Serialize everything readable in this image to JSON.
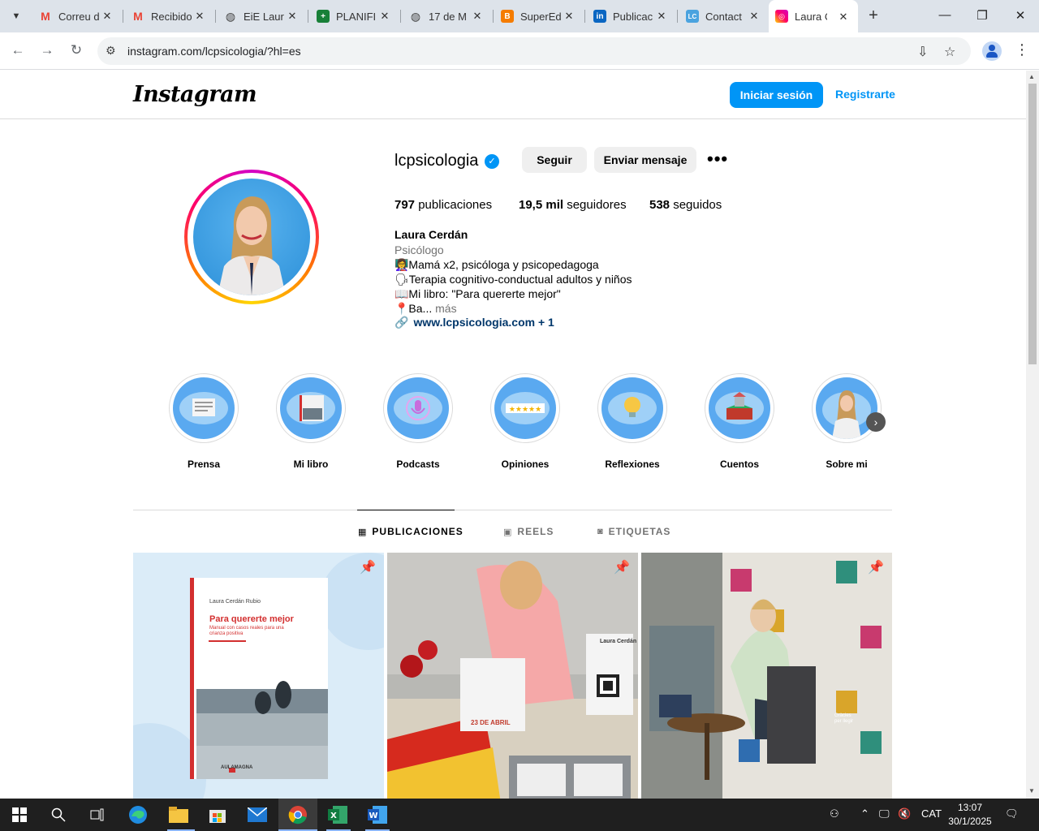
{
  "browser": {
    "tabs": [
      {
        "label": "Correu d",
        "favicon": "gmail-icon",
        "color": "#ea4335"
      },
      {
        "label": "Recibido",
        "favicon": "gmail-icon",
        "color": "#ea4335"
      },
      {
        "label": "EiE Laur",
        "favicon": "globe-icon",
        "color": "#444444"
      },
      {
        "label": "PLANIFI",
        "favicon": "sheets-icon",
        "color": "#188038"
      },
      {
        "label": "17 de M",
        "favicon": "globe-icon",
        "color": "#444444"
      },
      {
        "label": "SuperEd",
        "favicon": "blogger-icon",
        "color": "#f57c00"
      },
      {
        "label": "Publicac",
        "favicon": "linkedin-icon",
        "color": "#0a66c2"
      },
      {
        "label": "Contact",
        "favicon": "lc-icon",
        "color": "#4aa3df"
      },
      {
        "label": "Laura Ce",
        "favicon": "instagram-icon",
        "color": "#e1306c",
        "active": true
      }
    ],
    "url": "instagram.com/lcpsicologia/?hl=es"
  },
  "header": {
    "logo": "Instagram",
    "login_label": "Iniciar sesión",
    "register_label": "Registrarte"
  },
  "profile": {
    "username": "lcpsicologia",
    "follow_label": "Seguir",
    "message_label": "Enviar mensaje",
    "more_label": "•••",
    "stats": {
      "posts_count": "797",
      "posts_label": "publicaciones",
      "followers_count": "19,5 mil",
      "followers_label": "seguidores",
      "following_count": "538",
      "following_label": "seguidos"
    },
    "full_name": "Laura Cerdán",
    "category": "Psicólogo",
    "bio": [
      "👩‍🏫Mamá x2, psicóloga y psicopedagoga",
      "🗣Terapia cognitivo-conductual adultos y niños",
      "📖Mi libro: \"Para quererte mejor\"",
      "📍Ba..."
    ],
    "bio_more": "más",
    "link": "www.lcpsicologia.com + 1"
  },
  "highlights": [
    {
      "label": "Prensa"
    },
    {
      "label": "Mi libro"
    },
    {
      "label": "Podcasts"
    },
    {
      "label": "Opiniones"
    },
    {
      "label": "Reflexiones"
    },
    {
      "label": "Cuentos"
    },
    {
      "label": "Sobre mi"
    }
  ],
  "profile_tabs": {
    "posts": "PUBLICACIONES",
    "reels": "REELS",
    "tagged": "ETIQUETAS"
  },
  "posts": {
    "book": {
      "author": "Laura Cerdán Rubio",
      "title": "Para quererte mejor",
      "subtitle": "Manual con casos reales para una crianza positiva",
      "publisher": "AULAMAGNA"
    },
    "signing": {
      "date_sign": "23 DE ABRIL",
      "name_sign": "Laura Cerdán"
    },
    "event": {
      "banner_text": "Gràcies per llegir"
    }
  },
  "taskbar": {
    "lang": "CAT",
    "time": "13:07",
    "date": "30/1/2025"
  }
}
